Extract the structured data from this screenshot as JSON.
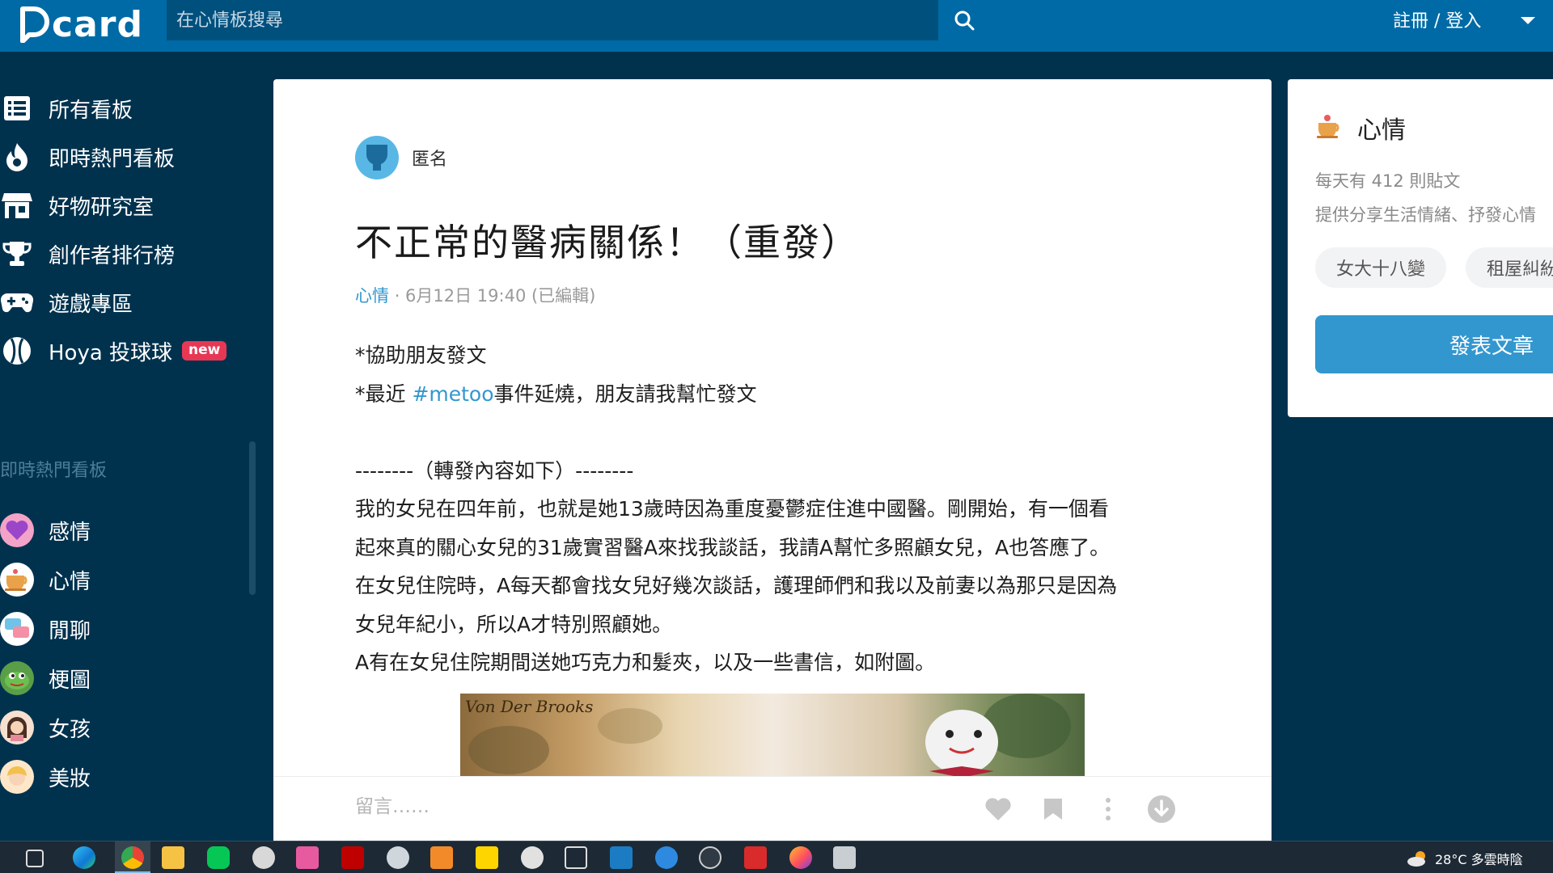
{
  "header": {
    "logo_text": "card",
    "search_placeholder": "在心情板搜尋",
    "auth_label": "註冊 / 登入"
  },
  "sidebar": {
    "items": [
      {
        "label": "所有看板",
        "icon": "list-icon"
      },
      {
        "label": "即時熱門看板",
        "icon": "fire-icon"
      },
      {
        "label": "好物研究室",
        "icon": "store-icon"
      },
      {
        "label": "創作者排行榜",
        "icon": "trophy-icon"
      },
      {
        "label": "遊戲專區",
        "icon": "gamepad-icon"
      },
      {
        "label": "Hoya 投球球",
        "icon": "baseball-icon",
        "badge": "new"
      }
    ],
    "section_title": "即時熱門看板",
    "boards": [
      {
        "label": "感情",
        "icon": "heart-board-icon"
      },
      {
        "label": "心情",
        "icon": "mood-board-icon"
      },
      {
        "label": "閒聊",
        "icon": "chat-board-icon"
      },
      {
        "label": "梗圖",
        "icon": "meme-board-icon"
      },
      {
        "label": "女孩",
        "icon": "girl-board-icon"
      },
      {
        "label": "美妝",
        "icon": "makeup-board-icon"
      }
    ]
  },
  "post": {
    "author": "匿名",
    "title": "不正常的醫病關係！（重發）",
    "forum": "心情",
    "meta": "· 6月12日 19:40 (已編輯)",
    "lines": [
      "*協助朋友發文",
      "*最近 ",
      "",
      "--------（轉發內容如下）--------",
      "我的女兒在四年前，也就是她13歲時因為重度憂鬱症住進中國醫。剛開始，有一個看",
      "起來真的關心女兒的31歲實習醫A來找我談話，我請A幫忙多照顧女兒，A也答應了。",
      "在女兒住院時，A每天都會找女兒好幾次談話，護理師們和我以及前妻以為那只是因為",
      "女兒年紀小，所以A才特別照顧她。",
      "A有在女兒住院期間送她巧克力和髮夾，以及一些書信，如附圖。"
    ],
    "hashtag": "#metoo",
    "line2_rest": "事件延燒，朋友請我幫忙發文",
    "image_caption": "Von Der Brooks",
    "comment_placeholder": "留言……"
  },
  "board_card": {
    "title": "心情",
    "daily": "每天有 412 則貼文",
    "desc": "提供分享生活情緒、抒發心情",
    "chips": [
      "女大十八變",
      "租屋糾紛"
    ],
    "post_button": "發表文章"
  },
  "taskbar": {
    "weather": "28°C 多雲時陰",
    "apps": [
      "task-view-icon",
      "edge-icon",
      "chrome-icon",
      "file-explorer-icon",
      "line-icon",
      "settings-icon",
      "calendar-icon",
      "filezilla-icon",
      "app-icon",
      "media-icon",
      "notes-icon",
      "cloud-icon",
      "camera-icon",
      "s-app-icon",
      "teams-icon",
      "browser-icon",
      "red-app-icon",
      "firefox-icon",
      "printer-icon"
    ]
  },
  "colors": {
    "topbar": "#006aa6",
    "background": "#00324e",
    "accent": "#3397cf",
    "badge": "#e63855"
  }
}
